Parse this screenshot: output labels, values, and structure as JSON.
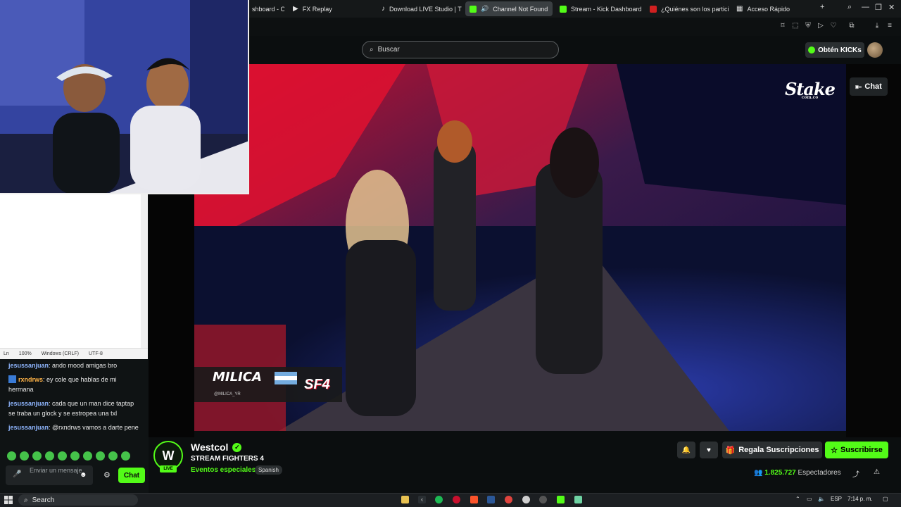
{
  "browser": {
    "tabs": [
      {
        "label": "shboard - Or",
        "color": "#ff6a3d"
      },
      {
        "label": "FX Replay",
        "color": "#ffffff"
      },
      {
        "label": "Download LIVE Studio | T",
        "color": "#ffffff"
      },
      {
        "label": "Channel Not Found",
        "color": "#53fc18"
      },
      {
        "label": "Stream - Kick Dashboard",
        "color": "#53fc18"
      },
      {
        "label": "¿Quiénes son los partici",
        "color": "#d02020"
      },
      {
        "label": "Acceso Rápido",
        "color": "#cccccc"
      }
    ],
    "new_tab": "+"
  },
  "header": {
    "search_placeholder": "Buscar",
    "kicks_label": "Obtén KICKs"
  },
  "video": {
    "chat_button": "Chat",
    "sponsor": "Stake",
    "sponsor_sub": "com.co",
    "overlay_name": "MILICA",
    "overlay_handle": "@MILICA_YR",
    "overlay_event": "SF4"
  },
  "notepad": {
    "status": [
      "Ln",
      "100%",
      "Windows (CRLF)",
      "UTF-8"
    ]
  },
  "chat": {
    "messages": [
      {
        "user": "jesussanjuan",
        "text": ": ando mood amigas bro",
        "color": "#8fb6ff"
      },
      {
        "user": "rxndrws",
        "text": ": ey cole que hablas de mi hermana",
        "color": "#ffb347"
      },
      {
        "user": "jesussanjuan",
        "text": ": cada que un man dice taptap se traba un glock y se estropea una txl",
        "color": "#8fb6ff"
      },
      {
        "user": "jesussanjuan",
        "text": ": @rxndrws vamos a darte pene",
        "color": "#8fb6ff"
      }
    ],
    "input_placeholder": "Enviar un mensaje",
    "send_label": "Chat"
  },
  "channel": {
    "name": "Westcol",
    "live_badge": "LIVE",
    "stream_title": "STREAM FIGHTERS 4",
    "category": "Eventos especiales",
    "language": "Spanish",
    "gift_label": "Regala Suscripciones",
    "subscribe_label": "Suscribirse",
    "viewers": "1.825.727",
    "viewers_label": "Espectadores"
  },
  "taskbar": {
    "search_label": "Search",
    "language": "ESP",
    "time": "7:14 p. m."
  }
}
